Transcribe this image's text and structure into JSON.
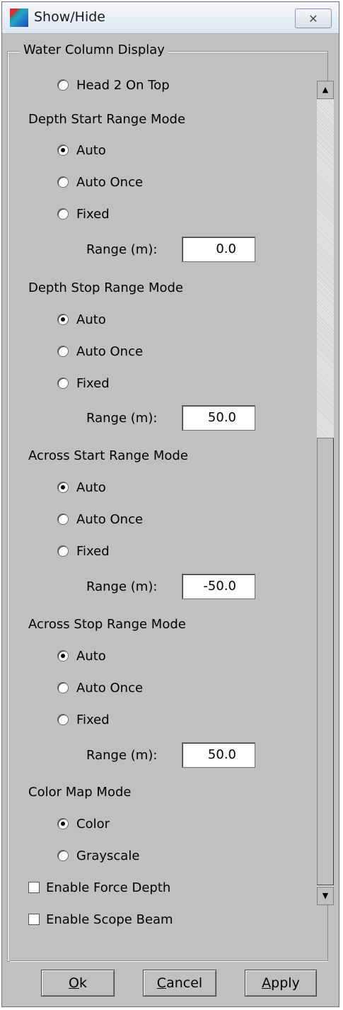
{
  "window": {
    "title": "Show/Hide",
    "close_glyph": "✕"
  },
  "group": {
    "legend": "Water Column Display"
  },
  "head2_on_top": {
    "label": "Head 2 On Top",
    "checked": false
  },
  "depth_start": {
    "heading": "Depth Start Range Mode",
    "options": [
      {
        "label": "Auto",
        "checked": true
      },
      {
        "label": "Auto Once",
        "checked": false
      },
      {
        "label": "Fixed",
        "checked": false
      }
    ],
    "range_label": "Range (m):",
    "range_value": "0.0"
  },
  "depth_stop": {
    "heading": "Depth Stop Range Mode",
    "options": [
      {
        "label": "Auto",
        "checked": true
      },
      {
        "label": "Auto Once",
        "checked": false
      },
      {
        "label": "Fixed",
        "checked": false
      }
    ],
    "range_label": "Range (m):",
    "range_value": "50.0"
  },
  "across_start": {
    "heading": "Across Start Range Mode",
    "options": [
      {
        "label": "Auto",
        "checked": true
      },
      {
        "label": "Auto Once",
        "checked": false
      },
      {
        "label": "Fixed",
        "checked": false
      }
    ],
    "range_label": "Range (m):",
    "range_value": "-50.0"
  },
  "across_stop": {
    "heading": "Across Stop Range Mode",
    "options": [
      {
        "label": "Auto",
        "checked": true
      },
      {
        "label": "Auto Once",
        "checked": false
      },
      {
        "label": "Fixed",
        "checked": false
      }
    ],
    "range_label": "Range (m):",
    "range_value": "50.0"
  },
  "color_map": {
    "heading": "Color Map Mode",
    "options": [
      {
        "label": "Color",
        "checked": true
      },
      {
        "label": "Grayscale",
        "checked": false
      }
    ]
  },
  "checkboxes": [
    {
      "label": "Enable Force Depth",
      "checked": false
    },
    {
      "label": "Enable Scope Beam",
      "checked": false
    }
  ],
  "buttons": {
    "ok": {
      "mnemonic": "O",
      "rest": "k"
    },
    "cancel": {
      "mnemonic": "C",
      "rest": "ancel"
    },
    "apply": {
      "mnemonic": "A",
      "rest": "pply"
    }
  },
  "icons": {
    "app": "app-colormap-icon",
    "close": "close-icon",
    "scroll_up": "arrow-up-icon",
    "scroll_down": "arrow-down-icon"
  },
  "colors": {
    "face": "#c0c0c0",
    "title_bar": "#dde6f0"
  }
}
